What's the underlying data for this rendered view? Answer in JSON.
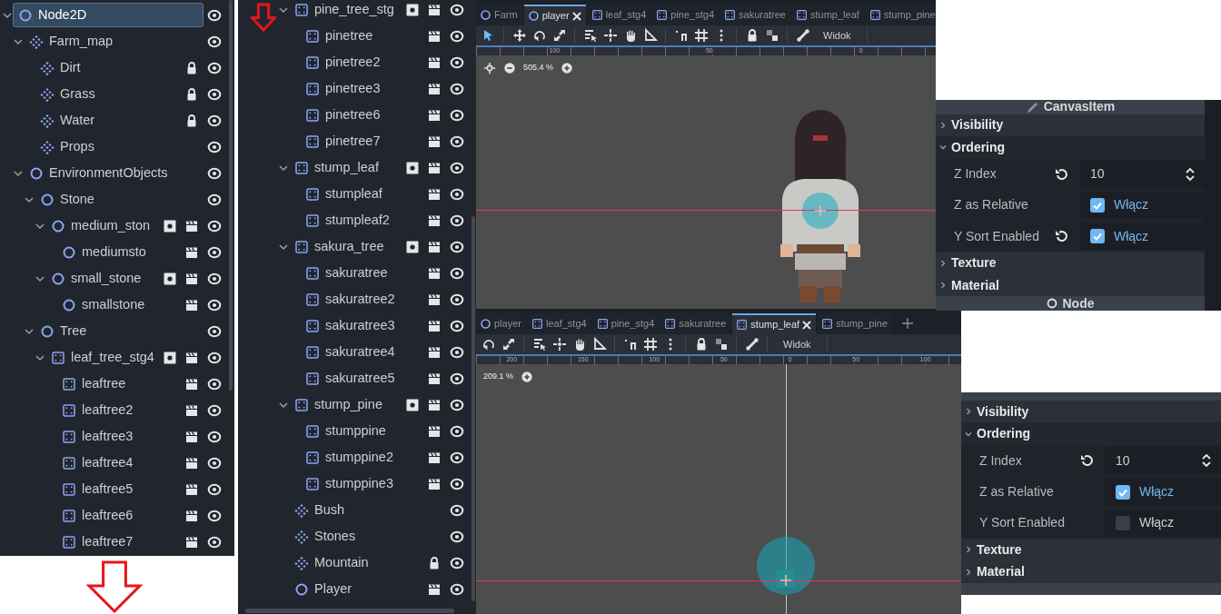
{
  "scene_tree": {
    "items": [
      {
        "label": "Node2D",
        "kind": "node2d",
        "selected": true,
        "expanded": true,
        "locked": false,
        "instance": false,
        "scene": false,
        "visible": true,
        "children": [
          {
            "label": "Farm_map",
            "kind": "tilemap",
            "selected": false,
            "expanded": true,
            "locked": false,
            "instance": false,
            "scene": false,
            "visible": true,
            "children": [
              {
                "label": "Dirt",
                "kind": "tilemap",
                "selected": false,
                "locked": true,
                "instance": false,
                "scene": false,
                "visible": true
              },
              {
                "label": "Grass",
                "kind": "tilemap",
                "selected": false,
                "locked": true,
                "instance": false,
                "scene": false,
                "visible": true
              },
              {
                "label": "Water",
                "kind": "tilemap",
                "selected": false,
                "locked": true,
                "instance": false,
                "scene": false,
                "visible": true
              },
              {
                "label": "Props",
                "kind": "tilemap",
                "selected": false,
                "locked": false,
                "instance": false,
                "scene": false,
                "visible": true
              }
            ]
          },
          {
            "label": "EnvironmentObjects",
            "kind": "node2d",
            "selected": false,
            "expanded": true,
            "locked": false,
            "instance": false,
            "scene": false,
            "visible": true,
            "children": [
              {
                "label": "Stone",
                "kind": "node2d",
                "selected": false,
                "expanded": true,
                "locked": false,
                "instance": false,
                "scene": false,
                "visible": true,
                "children": [
                  {
                    "label": "medium_ston",
                    "kind": "node2d",
                    "selected": false,
                    "expanded": true,
                    "locked": false,
                    "instance": true,
                    "scene": true,
                    "visible": true,
                    "children": [
                      {
                        "label": "mediumsto",
                        "kind": "node2d",
                        "selected": false,
                        "locked": false,
                        "instance": false,
                        "scene": true,
                        "visible": true
                      }
                    ]
                  },
                  {
                    "label": "small_stone",
                    "kind": "node2d",
                    "selected": false,
                    "expanded": true,
                    "locked": false,
                    "instance": true,
                    "scene": true,
                    "visible": true,
                    "children": [
                      {
                        "label": "smallstone",
                        "kind": "node2d",
                        "selected": false,
                        "locked": false,
                        "instance": false,
                        "scene": true,
                        "visible": true
                      }
                    ]
                  }
                ]
              },
              {
                "label": "Tree",
                "kind": "node2d",
                "selected": false,
                "expanded": true,
                "locked": false,
                "instance": false,
                "scene": false,
                "visible": true,
                "children": [
                  {
                    "label": "leaf_tree_stg4",
                    "kind": "sprite",
                    "selected": false,
                    "expanded": true,
                    "locked": false,
                    "instance": true,
                    "scene": true,
                    "visible": true,
                    "children": [
                      {
                        "label": "leaftree",
                        "kind": "sprite",
                        "selected": false,
                        "locked": false,
                        "instance": false,
                        "scene": true,
                        "visible": true
                      },
                      {
                        "label": "leaftree2",
                        "kind": "sprite",
                        "selected": false,
                        "locked": false,
                        "instance": false,
                        "scene": true,
                        "visible": true
                      },
                      {
                        "label": "leaftree3",
                        "kind": "sprite",
                        "selected": false,
                        "locked": false,
                        "instance": false,
                        "scene": true,
                        "visible": true
                      },
                      {
                        "label": "leaftree4",
                        "kind": "sprite",
                        "selected": false,
                        "locked": false,
                        "instance": false,
                        "scene": true,
                        "visible": true
                      },
                      {
                        "label": "leaftree5",
                        "kind": "sprite",
                        "selected": false,
                        "locked": false,
                        "instance": false,
                        "scene": true,
                        "visible": true
                      },
                      {
                        "label": "leaftree6",
                        "kind": "sprite",
                        "selected": false,
                        "locked": false,
                        "instance": false,
                        "scene": true,
                        "visible": true
                      },
                      {
                        "label": "leaftree7",
                        "kind": "sprite",
                        "selected": false,
                        "locked": false,
                        "instance": false,
                        "scene": true,
                        "visible": true
                      }
                    ]
                  }
                ]
              }
            ]
          }
        ]
      }
    ]
  },
  "scene_tree_continued": {
    "items": [
      {
        "label": "pine_tree_stg",
        "kind": "sprite",
        "selected": false,
        "expanded": true,
        "locked": false,
        "instance": true,
        "scene": true,
        "visible": true,
        "children": [
          {
            "label": "pinetree",
            "kind": "sprite",
            "selected": false,
            "locked": false,
            "instance": false,
            "scene": true,
            "visible": true
          },
          {
            "label": "pinetree2",
            "kind": "sprite",
            "selected": false,
            "locked": false,
            "instance": false,
            "scene": true,
            "visible": true
          },
          {
            "label": "pinetree3",
            "kind": "sprite",
            "selected": false,
            "locked": false,
            "instance": false,
            "scene": true,
            "visible": true
          },
          {
            "label": "pinetree6",
            "kind": "sprite",
            "selected": false,
            "locked": false,
            "instance": false,
            "scene": true,
            "visible": true
          },
          {
            "label": "pinetree7",
            "kind": "sprite",
            "selected": false,
            "locked": false,
            "instance": false,
            "scene": true,
            "visible": true
          }
        ]
      },
      {
        "label": "stump_leaf",
        "kind": "sprite",
        "selected": false,
        "expanded": true,
        "locked": false,
        "instance": true,
        "scene": true,
        "visible": true,
        "children": [
          {
            "label": "stumpleaf",
            "kind": "sprite",
            "selected": false,
            "locked": false,
            "instance": false,
            "scene": true,
            "visible": true
          },
          {
            "label": "stumpleaf2",
            "kind": "sprite",
            "selected": false,
            "locked": false,
            "instance": false,
            "scene": true,
            "visible": true
          }
        ]
      },
      {
        "label": "sakura_tree",
        "kind": "sprite",
        "selected": false,
        "expanded": true,
        "locked": false,
        "instance": true,
        "scene": true,
        "visible": true,
        "children": [
          {
            "label": "sakuratree",
            "kind": "sprite",
            "selected": false,
            "locked": false,
            "instance": false,
            "scene": true,
            "visible": true
          },
          {
            "label": "sakuratree2",
            "kind": "sprite",
            "selected": false,
            "locked": false,
            "instance": false,
            "scene": true,
            "visible": true
          },
          {
            "label": "sakuratree3",
            "kind": "sprite",
            "selected": false,
            "locked": false,
            "instance": false,
            "scene": true,
            "visible": true
          },
          {
            "label": "sakuratree4",
            "kind": "sprite",
            "selected": false,
            "locked": false,
            "instance": false,
            "scene": true,
            "visible": true
          },
          {
            "label": "sakuratree5",
            "kind": "sprite",
            "selected": false,
            "locked": false,
            "instance": false,
            "scene": true,
            "visible": true
          }
        ]
      },
      {
        "label": "stump_pine",
        "kind": "sprite",
        "selected": false,
        "expanded": true,
        "locked": false,
        "instance": true,
        "scene": true,
        "visible": true,
        "children": [
          {
            "label": "stumppine",
            "kind": "sprite",
            "selected": false,
            "locked": false,
            "instance": false,
            "scene": true,
            "visible": true
          },
          {
            "label": "stumppine2",
            "kind": "sprite",
            "selected": false,
            "locked": false,
            "instance": false,
            "scene": true,
            "visible": true
          },
          {
            "label": "stumppine3",
            "kind": "sprite",
            "selected": false,
            "locked": false,
            "instance": false,
            "scene": true,
            "visible": true
          }
        ]
      },
      {
        "label": "Bush",
        "kind": "tilemap",
        "selected": false,
        "locked": false,
        "instance": false,
        "scene": false,
        "visible": true
      },
      {
        "label": "Stones",
        "kind": "tilemap",
        "selected": false,
        "locked": false,
        "instance": false,
        "scene": false,
        "visible": true
      },
      {
        "label": "Mountain",
        "kind": "tilemap",
        "selected": false,
        "locked": true,
        "instance": false,
        "scene": false,
        "visible": true
      },
      {
        "label": "Player",
        "kind": "node2d",
        "selected": false,
        "locked": false,
        "instance": false,
        "scene": true,
        "visible": true
      }
    ]
  },
  "viewports": [
    {
      "tabs": [
        {
          "label": "Farm",
          "kind": "node2d",
          "selected": false
        },
        {
          "label": "player",
          "kind": "node2d",
          "selected": true
        },
        {
          "label": "leaf_stg4",
          "kind": "sprite",
          "selected": false
        },
        {
          "label": "pine_stg4",
          "kind": "sprite",
          "selected": false
        },
        {
          "label": "sakuratree",
          "kind": "sprite",
          "selected": false
        },
        {
          "label": "stump_leaf",
          "kind": "sprite",
          "selected": false
        },
        {
          "label": "stump_pine",
          "kind": "sprite",
          "selected": false
        }
      ],
      "new_tab": false,
      "menu": "Widok",
      "ruler": [
        "100",
        "50",
        "0"
      ],
      "zoom": "505.4 %",
      "kind": "character"
    },
    {
      "tabs": [
        {
          "label": "player",
          "kind": "node2d",
          "selected": false
        },
        {
          "label": "leaf_stg4",
          "kind": "sprite",
          "selected": false
        },
        {
          "label": "pine_stg4",
          "kind": "sprite",
          "selected": false
        },
        {
          "label": "sakuratree",
          "kind": "sprite",
          "selected": false
        },
        {
          "label": "stump_leaf",
          "kind": "sprite",
          "selected": true
        },
        {
          "label": "stump_pine",
          "kind": "sprite",
          "selected": false
        }
      ],
      "new_tab": true,
      "menu": "Widok",
      "ruler": [
        "200",
        "150",
        "100",
        "50",
        "0",
        "50",
        "100"
      ],
      "zoom": "209.1 %",
      "kind": "stump"
    }
  ],
  "inspectors": [
    {
      "header": "CanvasItem",
      "sections": [
        {
          "label": "Visibility",
          "expanded": false
        },
        {
          "label": "Ordering",
          "expanded": true,
          "properties": [
            {
              "label": "Z Index",
              "kind": "spin",
              "revert": true,
              "value": "10"
            },
            {
              "label": "Z as Relative",
              "kind": "check",
              "revert": false,
              "checked": true,
              "value": "Włącz"
            },
            {
              "label": "Y Sort Enabled",
              "kind": "check",
              "revert": true,
              "checked": true,
              "value": "Włącz"
            }
          ]
        },
        {
          "label": "Texture",
          "expanded": false
        },
        {
          "label": "Material",
          "expanded": false
        }
      ],
      "footer": "Node"
    },
    {
      "sections": [
        {
          "label": "Visibility",
          "expanded": false
        },
        {
          "label": "Ordering",
          "expanded": true,
          "properties": [
            {
              "label": "Z Index",
              "kind": "spin",
              "revert": true,
              "value": "10"
            },
            {
              "label": "Z as Relative",
              "kind": "check",
              "revert": false,
              "checked": true,
              "value": "Włącz"
            },
            {
              "label": "Y Sort Enabled",
              "kind": "check",
              "revert": false,
              "checked": false,
              "value": "Włącz"
            }
          ]
        },
        {
          "label": "Texture",
          "expanded": false
        },
        {
          "label": "Material",
          "expanded": false
        }
      ]
    }
  ]
}
